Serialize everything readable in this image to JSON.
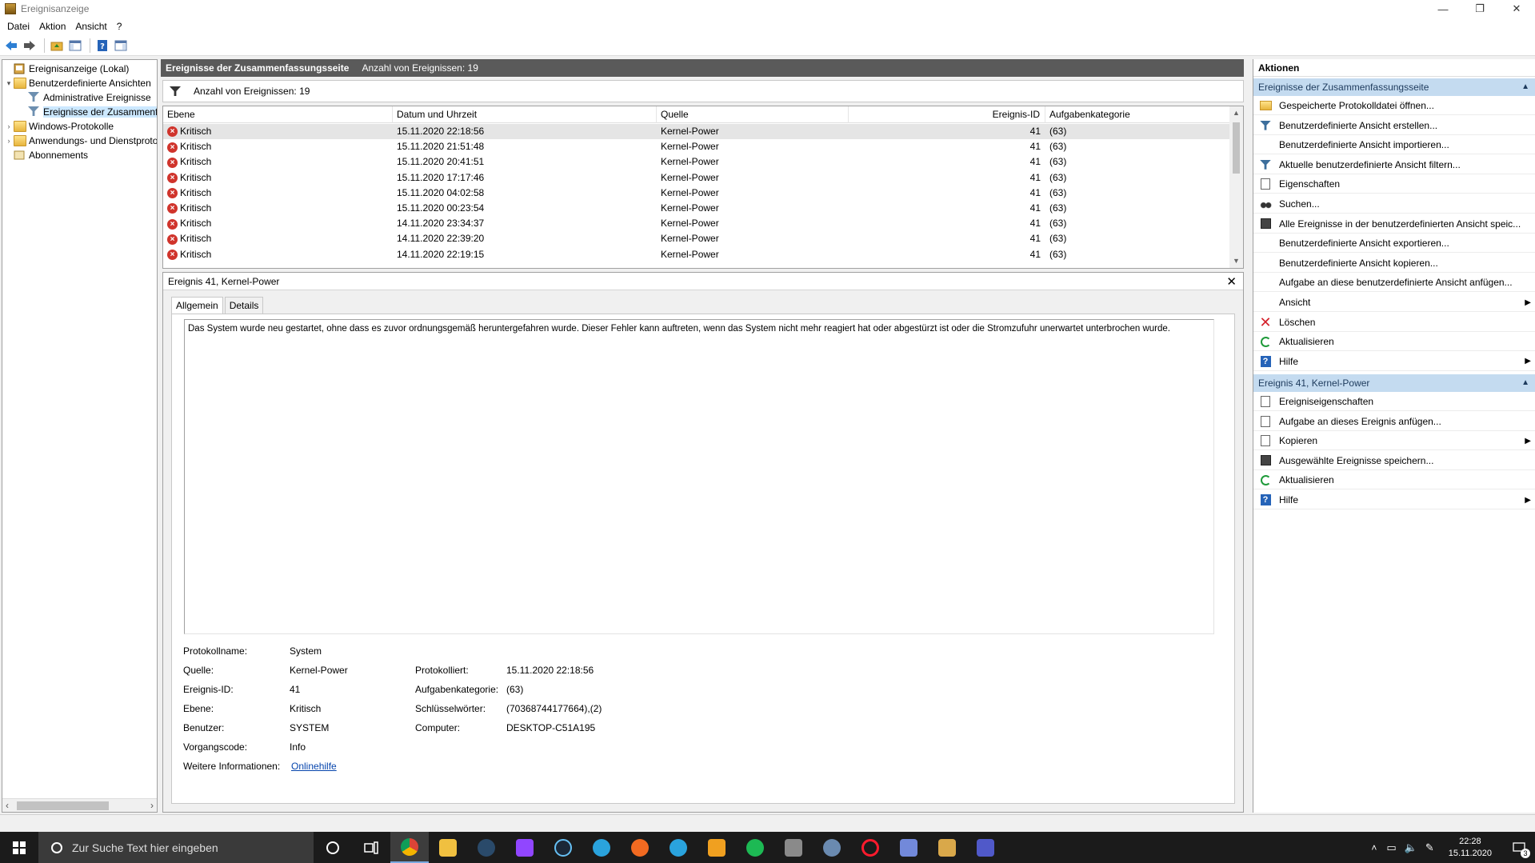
{
  "window": {
    "title": "Ereignisanzeige",
    "min": "—",
    "restore": "❐",
    "close": "✕"
  },
  "menu": [
    "Datei",
    "Aktion",
    "Ansicht",
    "?"
  ],
  "tree": {
    "items": [
      {
        "label": "Ereignisanzeige (Lokal)",
        "level": 0,
        "toggle": "",
        "icon": "computer-icon"
      },
      {
        "label": "Benutzerdefinierte Ansichten",
        "level": 0,
        "toggle": "▾",
        "icon": "folder-icon"
      },
      {
        "label": "Administrative Ereignisse",
        "level": 1,
        "toggle": "",
        "icon": "filter-icon"
      },
      {
        "label": "Ereignisse der Zusammenfassungsseite",
        "level": 1,
        "toggle": "",
        "icon": "filter-icon",
        "selected": true
      },
      {
        "label": "Windows-Protokolle",
        "level": 0,
        "toggle": "›",
        "icon": "folder-icon"
      },
      {
        "label": "Anwendungs- und Dienstprotokolle",
        "level": 0,
        "toggle": "›",
        "icon": "folder-icon"
      },
      {
        "label": "Abonnements",
        "level": 0,
        "toggle": "",
        "icon": "subscription-icon"
      }
    ],
    "scroll_left": "‹",
    "scroll_right": "›"
  },
  "center": {
    "header_title": "Ereignisse der Zusammenfassungsseite",
    "header_count": "Anzahl von Ereignissen: 19",
    "filter_text": "Anzahl von Ereignissen: 19",
    "columns": [
      "Ebene",
      "Datum und Uhrzeit",
      "Quelle",
      "Ereignis-ID",
      "Aufgabenkategorie"
    ],
    "rows": [
      {
        "level": "Kritisch",
        "date": "15.11.2020 22:18:56",
        "source": "Kernel-Power",
        "id": "41",
        "cat": "(63)"
      },
      {
        "level": "Kritisch",
        "date": "15.11.2020 21:51:48",
        "source": "Kernel-Power",
        "id": "41",
        "cat": "(63)"
      },
      {
        "level": "Kritisch",
        "date": "15.11.2020 20:41:51",
        "source": "Kernel-Power",
        "id": "41",
        "cat": "(63)"
      },
      {
        "level": "Kritisch",
        "date": "15.11.2020 17:17:46",
        "source": "Kernel-Power",
        "id": "41",
        "cat": "(63)"
      },
      {
        "level": "Kritisch",
        "date": "15.11.2020 04:02:58",
        "source": "Kernel-Power",
        "id": "41",
        "cat": "(63)"
      },
      {
        "level": "Kritisch",
        "date": "15.11.2020 00:23:54",
        "source": "Kernel-Power",
        "id": "41",
        "cat": "(63)"
      },
      {
        "level": "Kritisch",
        "date": "14.11.2020 23:34:37",
        "source": "Kernel-Power",
        "id": "41",
        "cat": "(63)"
      },
      {
        "level": "Kritisch",
        "date": "14.11.2020 22:39:20",
        "source": "Kernel-Power",
        "id": "41",
        "cat": "(63)"
      },
      {
        "level": "Kritisch",
        "date": "14.11.2020 22:19:15",
        "source": "Kernel-Power",
        "id": "41",
        "cat": "(63)"
      }
    ],
    "scroll_up": "▲",
    "scroll_down": "▼"
  },
  "detail": {
    "title": "Ereignis 41, Kernel-Power",
    "close": "✕",
    "tabs": [
      "Allgemein",
      "Details"
    ],
    "message": "Das System wurde neu gestartet, ohne dass es zuvor ordnungsgemäß heruntergefahren wurde. Dieser Fehler kann auftreten, wenn das System nicht mehr reagiert hat oder abgestürzt ist oder die Stromzufuhr unerwartet unterbrochen wurde.",
    "props": {
      "log_name_label": "Protokollname:",
      "log_name": "System",
      "source_label": "Quelle:",
      "source": "Kernel-Power",
      "logged_label": "Protokolliert:",
      "logged": "15.11.2020 22:18:56",
      "event_id_label": "Ereignis-ID:",
      "event_id": "41",
      "task_cat_label": "Aufgabenkategorie:",
      "task_cat": "(63)",
      "level_label": "Ebene:",
      "level": "Kritisch",
      "keywords_label": "Schlüsselwörter:",
      "keywords": "(70368744177664),(2)",
      "user_label": "Benutzer:",
      "user": "SYSTEM",
      "computer_label": "Computer:",
      "computer": "DESKTOP-C51A195",
      "opcode_label": "Vorgangscode:",
      "opcode": "Info",
      "more_info_label": "Weitere Informationen:",
      "more_info_link": "Onlinehilfe"
    }
  },
  "actions": {
    "header": "Aktionen",
    "section1": {
      "title": "Ereignisse der Zusammenfassungsseite",
      "caret": "▲"
    },
    "items1": [
      {
        "label": "Gespeicherte Protokolldatei öffnen...",
        "icon": "folder-open-icon"
      },
      {
        "label": "Benutzerdefinierte Ansicht erstellen...",
        "icon": "filter-create-icon"
      },
      {
        "label": "Benutzerdefinierte Ansicht importieren...",
        "icon": ""
      },
      {
        "label": "Aktuelle benutzerdefinierte Ansicht filtern...",
        "icon": "filter-icon"
      },
      {
        "label": "Eigenschaften",
        "icon": "properties-icon"
      },
      {
        "label": "Suchen...",
        "icon": "binoculars-icon"
      },
      {
        "label": "Alle Ereignisse in der benutzerdefinierten Ansicht speic...",
        "icon": "save-icon"
      },
      {
        "label": "Benutzerdefinierte Ansicht exportieren...",
        "icon": ""
      },
      {
        "label": "Benutzerdefinierte Ansicht kopieren...",
        "icon": ""
      },
      {
        "label": "Aufgabe an diese benutzerdefinierte Ansicht anfügen...",
        "icon": ""
      },
      {
        "label": "Ansicht",
        "icon": "",
        "submenu": "▶"
      },
      {
        "label": "Löschen",
        "icon": "delete-icon"
      },
      {
        "label": "Aktualisieren",
        "icon": "refresh-icon"
      },
      {
        "label": "Hilfe",
        "icon": "help-icon",
        "submenu": "▶"
      }
    ],
    "section2": {
      "title": "Ereignis 41, Kernel-Power",
      "caret": "▲"
    },
    "items2": [
      {
        "label": "Ereigniseigenschaften",
        "icon": "properties-icon"
      },
      {
        "label": "Aufgabe an dieses Ereignis anfügen...",
        "icon": "task-icon"
      },
      {
        "label": "Kopieren",
        "icon": "copy-icon",
        "submenu": "▶"
      },
      {
        "label": "Ausgewählte Ereignisse speichern...",
        "icon": "save-icon"
      },
      {
        "label": "Aktualisieren",
        "icon": "refresh-icon"
      },
      {
        "label": "Hilfe",
        "icon": "help-icon",
        "submenu": "▶"
      }
    ]
  },
  "taskbar": {
    "search_placeholder": "Zur Suche Text hier eingeben",
    "time": "22:28",
    "date": "15.11.2020",
    "notif_count": "3"
  },
  "colors": {
    "accent": "#c4dbf0",
    "critical": "#d0342c",
    "header_gray": "#5a5a5a"
  }
}
